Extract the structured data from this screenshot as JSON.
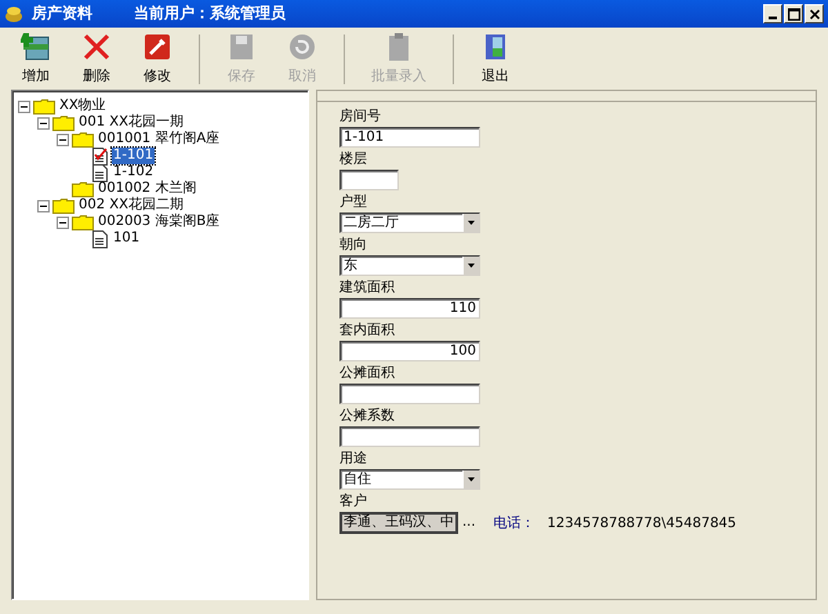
{
  "window": {
    "title": "房产资料",
    "user_label": "当前用户：系统管理员"
  },
  "toolbar": [
    {
      "label": "增加",
      "kind": "add",
      "disabled": false
    },
    {
      "label": "删除",
      "kind": "delete",
      "disabled": false
    },
    {
      "label": "修改",
      "kind": "edit",
      "disabled": false
    },
    {
      "label": "保存",
      "kind": "save",
      "disabled": true
    },
    {
      "label": "取消",
      "kind": "cancel",
      "disabled": true
    },
    {
      "label": "批量录入",
      "kind": "batch",
      "disabled": true
    },
    {
      "label": "退出",
      "kind": "exit",
      "disabled": false
    }
  ],
  "tree": [
    {
      "label": "XX物业",
      "kind": "folder",
      "expanded": true,
      "selected": false,
      "children": [
        {
          "label": "001 XX花园一期",
          "kind": "folder",
          "expanded": true,
          "selected": false,
          "children": [
            {
              "label": "001001 翠竹阁A座",
              "kind": "folder",
              "expanded": true,
              "selected": false,
              "children": [
                {
                  "label": "1-101",
                  "kind": "document",
                  "checked": true,
                  "selected": true
                },
                {
                  "label": "1-102",
                  "kind": "document",
                  "checked": false,
                  "selected": false
                }
              ]
            },
            {
              "label": "001002 木兰阁",
              "kind": "folder",
              "selected": false
            }
          ]
        },
        {
          "label": "002 XX花园二期",
          "kind": "folder",
          "expanded": true,
          "selected": false,
          "children": [
            {
              "label": "002003 海棠阁B座",
              "kind": "folder",
              "expanded": true,
              "selected": false,
              "children": [
                {
                  "label": "101",
                  "kind": "document",
                  "checked": false,
                  "selected": false
                }
              ]
            }
          ]
        }
      ]
    }
  ],
  "form": [
    {
      "label": "房间号",
      "kind": "text",
      "value": "1-101"
    },
    {
      "label": "楼层",
      "kind": "short"
    },
    {
      "label": "户型",
      "kind": "combo",
      "value": "二房二厅"
    },
    {
      "label": "朝向",
      "kind": "combo",
      "value": "东"
    },
    {
      "label": "建筑面积",
      "kind": "number",
      "value": "110"
    },
    {
      "label": "套内面积",
      "kind": "number",
      "value": "100"
    },
    {
      "label": "公摊面积",
      "kind": "text"
    },
    {
      "label": "公摊系数",
      "kind": "text"
    },
    {
      "label": "用途",
      "kind": "combo",
      "value": "自住"
    },
    {
      "label": "客户",
      "kind": "customer",
      "value": "李通、王码汉、中",
      "button": "...",
      "phone_label": "电话：",
      "phone": "1234578788778\\45487845"
    }
  ]
}
